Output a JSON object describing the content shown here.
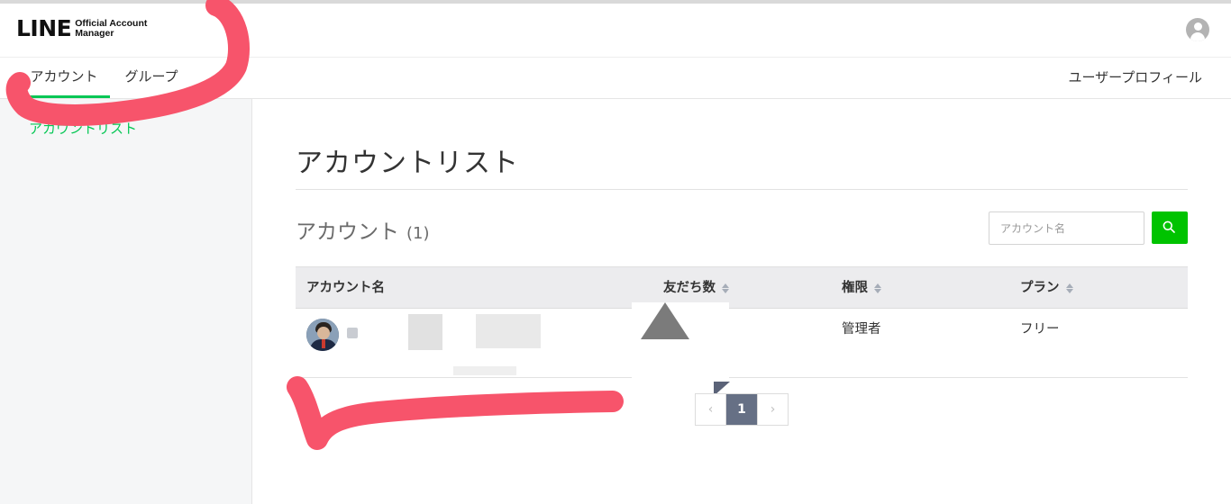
{
  "header": {
    "logo_main": "LINE",
    "logo_sub_line1": "Official Account",
    "logo_sub_line2": "Manager",
    "profile_icon": "user-circle-icon"
  },
  "nav": {
    "tabs": [
      {
        "label": "アカウント",
        "active": true
      },
      {
        "label": "グループ",
        "active": false
      }
    ],
    "right_link": "ユーザープロフィール",
    "accent_color": "#06c755"
  },
  "sidebar": {
    "items": [
      {
        "label": "アカウントリスト"
      }
    ]
  },
  "main": {
    "page_title": "アカウントリスト",
    "section_title": "アカウント",
    "section_count": "(1)",
    "search": {
      "placeholder": "アカウント名",
      "value": "",
      "button_icon": "search-icon",
      "button_color": "#00c300"
    },
    "table": {
      "columns": [
        "アカウント名",
        "友だち数",
        "権限",
        "プラン"
      ],
      "sortable": [
        false,
        true,
        true,
        true
      ],
      "rows": [
        {
          "name": "",
          "friends": "",
          "role": "管理者",
          "plan": "フリー"
        }
      ]
    },
    "pagination": {
      "prev": "‹",
      "current": "1",
      "next": "›",
      "active_color": "#667085"
    }
  },
  "annotation_color": "#f7546b"
}
